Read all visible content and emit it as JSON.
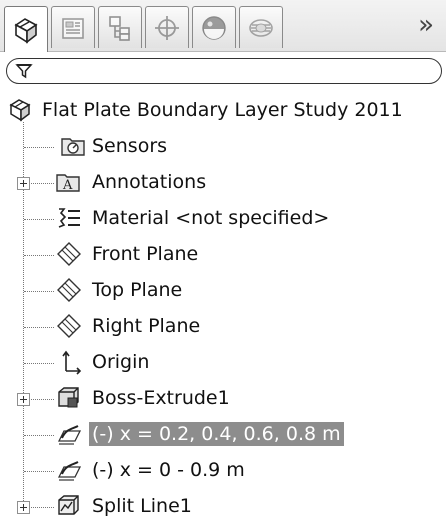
{
  "tabs": [
    {
      "name": "featuremanager-tab",
      "active": true
    },
    {
      "name": "propertymanager-tab",
      "active": false
    },
    {
      "name": "configurationmanager-tab",
      "active": false
    },
    {
      "name": "dimxpert-tab",
      "active": false
    },
    {
      "name": "display-manager-tab",
      "active": false
    },
    {
      "name": "flow-simulation-tab",
      "active": false
    }
  ],
  "more_label": "»",
  "tree": {
    "root": "Flat Plate Boundary Layer Study 2011",
    "items": [
      {
        "label": "Sensors",
        "icon": "sensors-icon",
        "expandable": false,
        "selected": false
      },
      {
        "label": "Annotations",
        "icon": "annotations-icon",
        "expandable": true,
        "selected": false
      },
      {
        "label": "Material <not specified>",
        "icon": "material-icon",
        "expandable": false,
        "selected": false
      },
      {
        "label": "Front Plane",
        "icon": "plane-icon",
        "expandable": false,
        "selected": false
      },
      {
        "label": "Top Plane",
        "icon": "plane-icon",
        "expandable": false,
        "selected": false
      },
      {
        "label": "Right Plane",
        "icon": "plane-icon",
        "expandable": false,
        "selected": false
      },
      {
        "label": "Origin",
        "icon": "origin-icon",
        "expandable": false,
        "selected": false
      },
      {
        "label": "Boss-Extrude1",
        "icon": "extrude-icon",
        "expandable": true,
        "selected": false
      },
      {
        "label": "(-) x = 0.2, 0.4, 0.6, 0.8 m",
        "icon": "sketch-icon",
        "expandable": false,
        "selected": true
      },
      {
        "label": "(-) x = 0 - 0.9 m",
        "icon": "sketch-icon",
        "expandable": false,
        "selected": false
      },
      {
        "label": "Split Line1",
        "icon": "split-line-icon",
        "expandable": true,
        "selected": false
      }
    ]
  },
  "colors": {
    "selection": "#8d8d8d",
    "tab_border": "#8a8a8a"
  }
}
